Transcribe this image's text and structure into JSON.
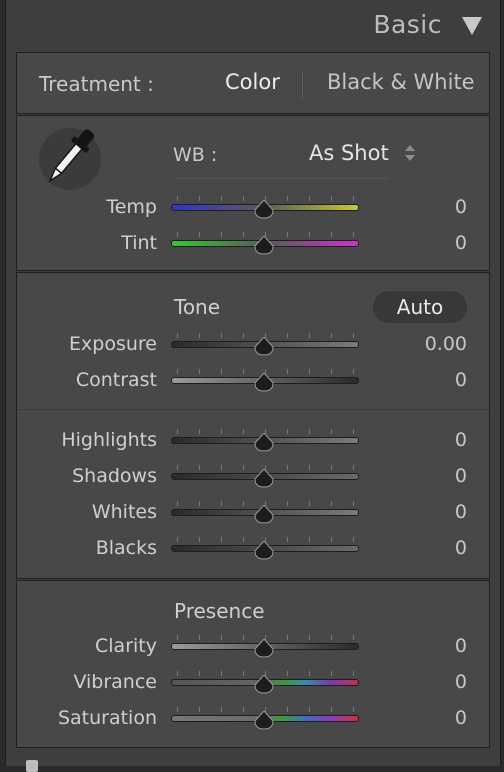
{
  "panel": {
    "title": "Basic"
  },
  "treatment": {
    "label": "Treatment :",
    "options": [
      "Color",
      "Black & White"
    ],
    "selected": "Color"
  },
  "wb": {
    "label": "WB :",
    "value": "As Shot",
    "sliders": [
      {
        "label": "Temp",
        "value": "0",
        "level": 0.5
      },
      {
        "label": "Tint",
        "value": "0",
        "level": 0.5
      }
    ]
  },
  "tone": {
    "title": "Tone",
    "auto_label": "Auto",
    "sliders": [
      {
        "label": "Exposure",
        "value": "0.00",
        "level": 0.5
      },
      {
        "label": "Contrast",
        "value": "0",
        "level": 0.5
      },
      {
        "label": "Highlights",
        "value": "0",
        "level": 0.5
      },
      {
        "label": "Shadows",
        "value": "0",
        "level": 0.5
      },
      {
        "label": "Whites",
        "value": "0",
        "level": 0.5
      },
      {
        "label": "Blacks",
        "value": "0",
        "level": 0.5
      }
    ]
  },
  "presence": {
    "title": "Presence",
    "sliders": [
      {
        "label": "Clarity",
        "value": "0",
        "level": 0.5
      },
      {
        "label": "Vibrance",
        "value": "0",
        "level": 0.5
      },
      {
        "label": "Saturation",
        "value": "0",
        "level": 0.5
      }
    ]
  },
  "icons": {
    "collapse": "triangle-down-icon",
    "eyedropper": "eyedropper-icon",
    "stepper": "up-down-stepper-icon"
  },
  "colors": {
    "panel_bg": "#484848",
    "frame_bg": "#3e3e3e",
    "temp_gradient": [
      "#3b3bd6",
      "#d9d93a"
    ],
    "tint_gradient": [
      "#3bd63b",
      "#d63bd6"
    ]
  }
}
